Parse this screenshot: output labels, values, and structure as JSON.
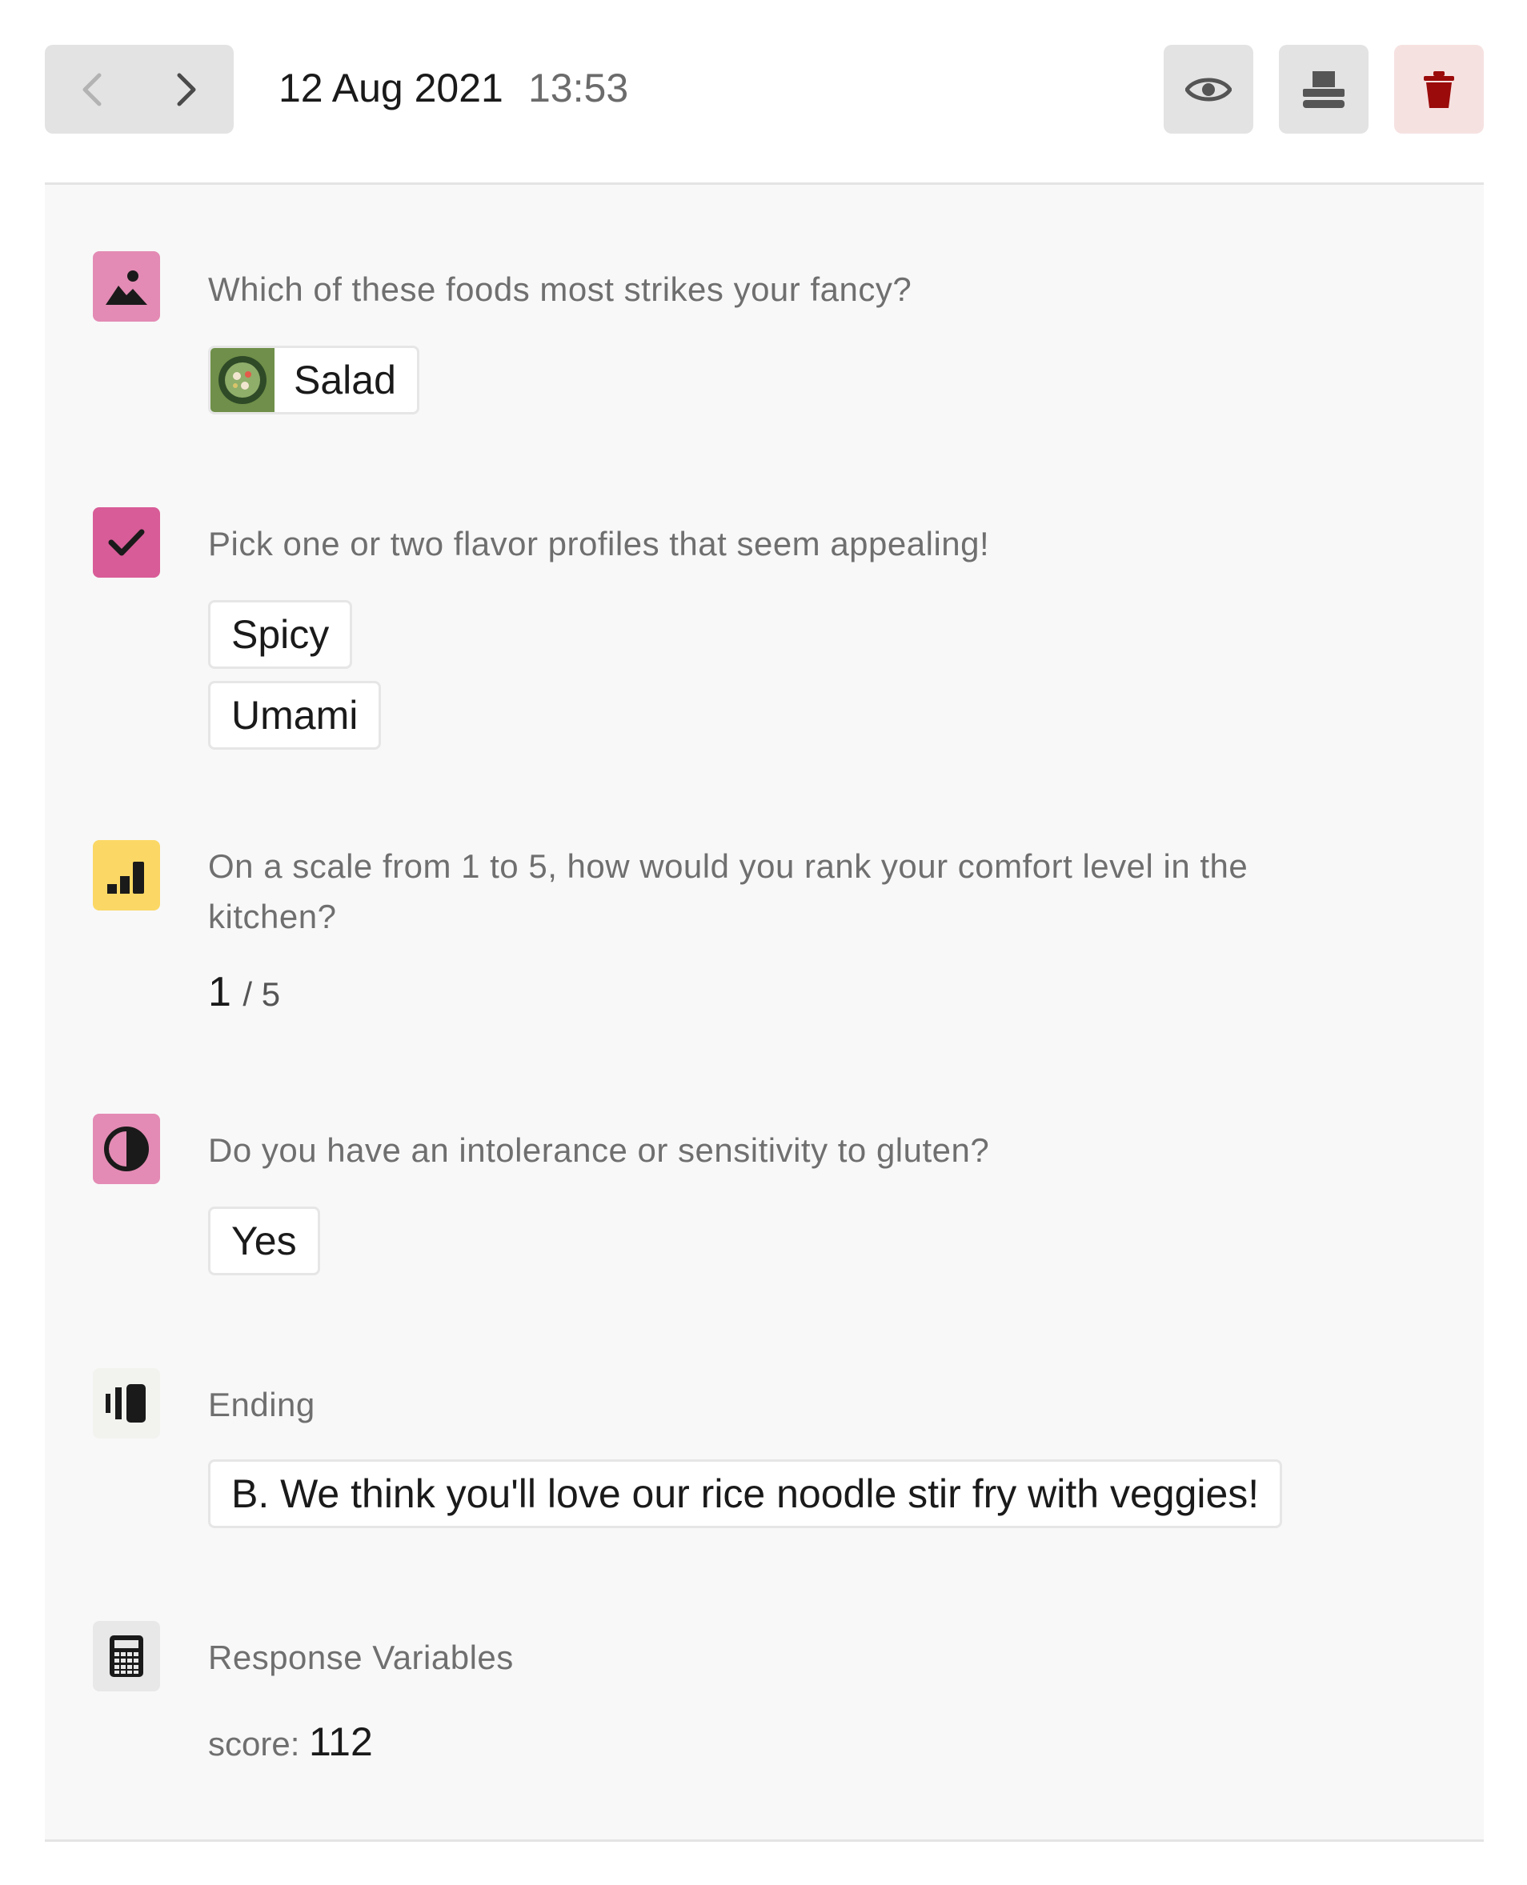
{
  "header": {
    "date": "12 Aug 2021",
    "time": "13:53",
    "icons": {
      "prev": "chevron-left-icon",
      "next": "chevron-right-icon",
      "view": "eye-icon",
      "print": "printer-icon",
      "delete": "trash-icon"
    }
  },
  "questions": [
    {
      "type": "picture-choice",
      "icon": "image-icon",
      "icon_bg": "#e38bb4",
      "label": "Which of these foods most strikes your fancy?",
      "answers": [
        "Salad"
      ]
    },
    {
      "type": "multiple-choice",
      "icon": "checkmark-icon",
      "icon_bg": "#d85c97",
      "label": "Pick one or two flavor profiles that seem appealing!",
      "answers": [
        "Spicy",
        "Umami"
      ]
    },
    {
      "type": "opinion-scale",
      "icon": "bar-chart-icon",
      "icon_bg": "#fbd865",
      "label": "On a scale from 1 to 5, how would you rank your comfort level in the kitchen?",
      "value": "1",
      "max": "/ 5"
    },
    {
      "type": "yes-no",
      "icon": "half-circle-icon",
      "icon_bg": "#e38bb4",
      "label": "Do you have an intolerance or sensitivity to gluten?",
      "answers": [
        "Yes"
      ]
    },
    {
      "type": "ending",
      "icon": "ending-icon",
      "icon_bg": "#f2f2ef",
      "label": "Ending",
      "answers": [
        "B. We think you'll love our rice noodle stir fry with veggies!"
      ]
    },
    {
      "type": "variables",
      "icon": "calculator-icon",
      "icon_bg": "#e8e8e8",
      "label": "Response Variables",
      "score_label": "score:",
      "score_value": "112"
    }
  ]
}
